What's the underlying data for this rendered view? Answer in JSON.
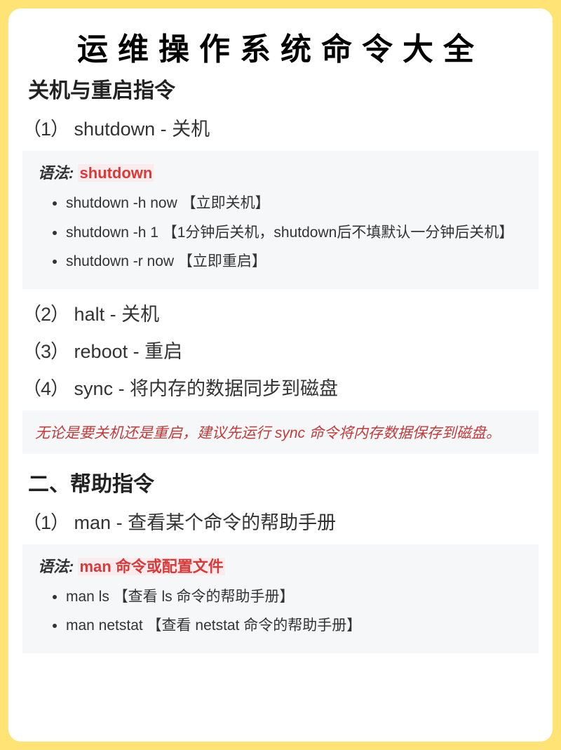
{
  "title": "运维操作系统命令大全",
  "section1": {
    "heading": "关机与重启指令",
    "items": [
      {
        "num": "（1）",
        "text": "shutdown - 关机"
      },
      {
        "num": "（2）",
        "text": "halt - 关机"
      },
      {
        "num": "（3）",
        "text": "reboot - 重启"
      },
      {
        "num": "（4）",
        "text": "sync - 将内存的数据同步到磁盘"
      }
    ],
    "syntax1": {
      "label": "语法:",
      "cmd": "shutdown",
      "bullets": [
        "shutdown -h now 【立即关机】",
        "shutdown -h 1 【1分钟后关机，shutdown后不填默认一分钟后关机】",
        "shutdown -r now 【立即重启】"
      ]
    },
    "tip": "无论是要关机还是重启，建议先运行 sync 命令将内存数据保存到磁盘。"
  },
  "section2": {
    "heading": "二、帮助指令",
    "items": [
      {
        "num": "（1）",
        "text": "man - 查看某个命令的帮助手册"
      }
    ],
    "syntax1": {
      "label": "语法:",
      "cmd": "man 命令或配置文件",
      "bullets": [
        "man ls 【查看 ls 命令的帮助手册】",
        "man netstat 【查看 netstat 命令的帮助手册】"
      ]
    }
  }
}
